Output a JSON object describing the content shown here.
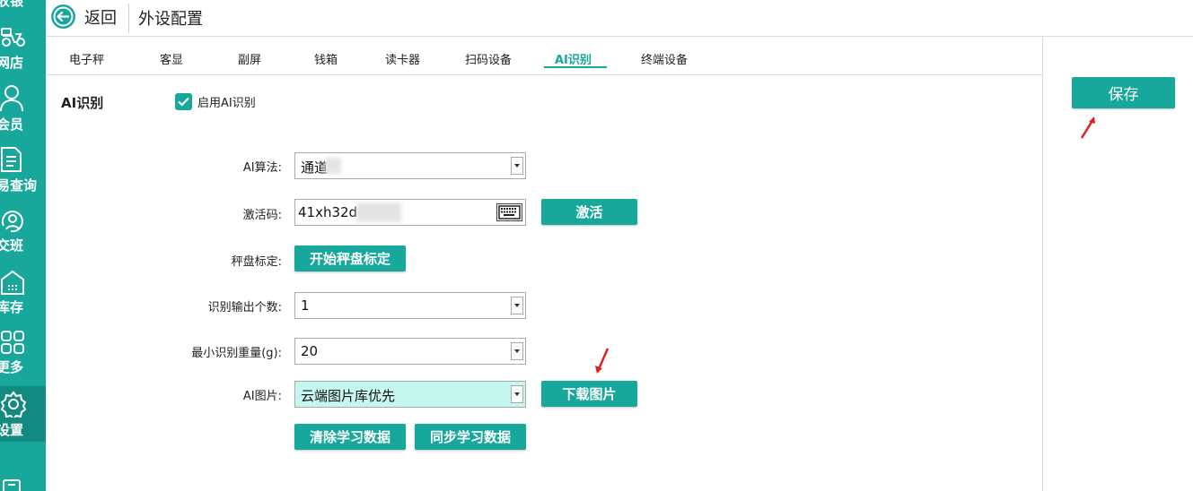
{
  "sidebar": {
    "items": [
      {
        "label": "收银",
        "icon": "cashier-icon"
      },
      {
        "label": "网店",
        "icon": "delivery-scooter-icon"
      },
      {
        "label": "会员",
        "icon": "user-icon"
      },
      {
        "label": "易查询",
        "icon": "document-icon"
      },
      {
        "label": "交班",
        "icon": "shift-handover-icon"
      },
      {
        "label": "库存",
        "icon": "warehouse-icon"
      },
      {
        "label": "更多",
        "icon": "grid-icon"
      },
      {
        "label": "设置",
        "icon": "gear-icon"
      }
    ],
    "active": "设置"
  },
  "header": {
    "back_label": "返回",
    "title": "外设配置"
  },
  "tabs": [
    {
      "label": "电子秤"
    },
    {
      "label": "客显"
    },
    {
      "label": "副屏"
    },
    {
      "label": "钱箱"
    },
    {
      "label": "读卡器"
    },
    {
      "label": "扫码设备"
    },
    {
      "label": "AI识别"
    },
    {
      "label": "终端设备"
    }
  ],
  "active_tab": "AI识别",
  "section": {
    "title": "AI识别",
    "enable_label": "启用AI识别",
    "enable_checked": true
  },
  "form": {
    "algorithm_label": "AI算法:",
    "algorithm_value": "通道",
    "activation_label": "激活码:",
    "activation_value": "41xh32d",
    "activate_button": "激活",
    "calibration_label": "秤盘标定:",
    "calibration_button": "开始秤盘标定",
    "output_count_label": "识别输出个数:",
    "output_count_value": "1",
    "min_weight_label": "最小识别重量(g):",
    "min_weight_value": "20",
    "ai_image_label": "AI图片:",
    "ai_image_value": "云端图片库优先",
    "download_button": "下载图片",
    "clear_button": "清除学习数据",
    "sync_button": "同步学习数据"
  },
  "save_label": "保存",
  "colors": {
    "accent": "#18a89b",
    "accent_dark": "#138a80",
    "highlight_field": "#c6f7ee",
    "annotation_arrow": "#e02020"
  }
}
